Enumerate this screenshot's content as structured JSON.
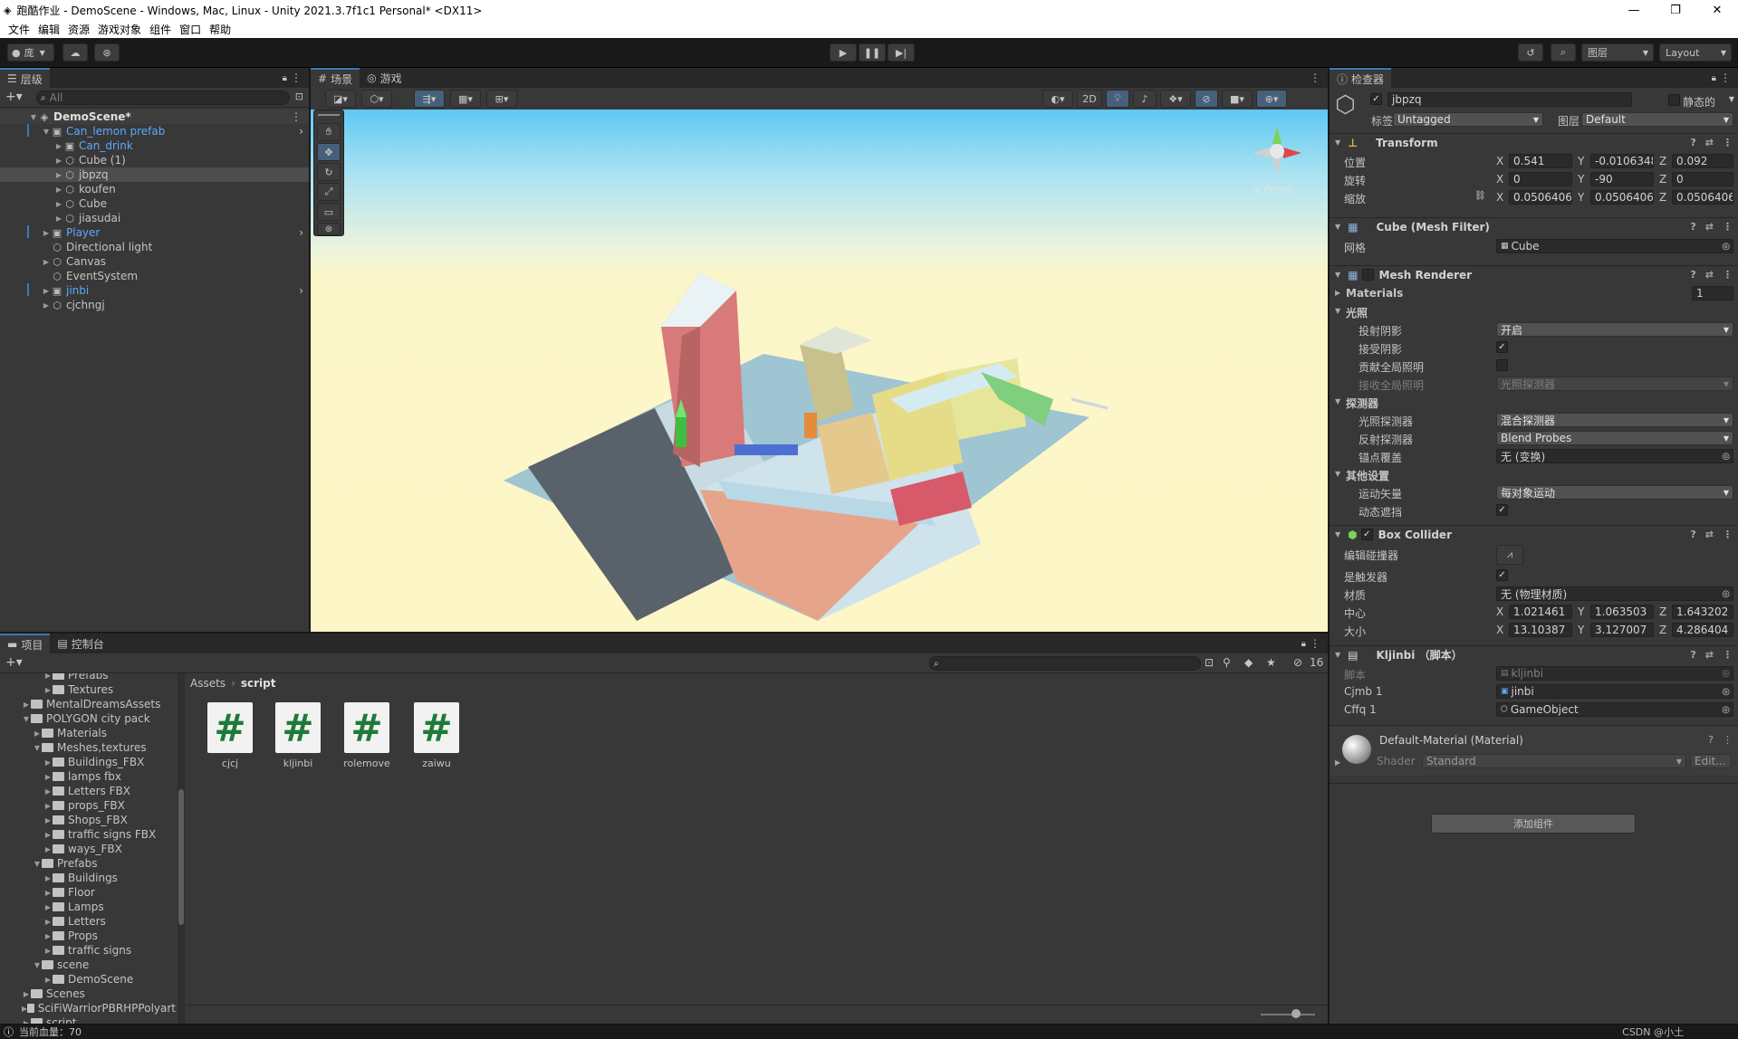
{
  "window": {
    "title": "跑酷作业 - DemoScene - Windows, Mac, Linux - Unity 2021.3.7f1c1 Personal* <DX11>",
    "controls": [
      "—",
      "❐",
      "✕"
    ]
  },
  "menu": [
    "文件",
    "编辑",
    "资源",
    "游戏对象",
    "组件",
    "窗口",
    "帮助"
  ],
  "toolbar": {
    "account": "庞",
    "layers": "图层",
    "layout": "Layout"
  },
  "hierarchy": {
    "tab": "层级",
    "search_placeholder": "All",
    "scene": "DemoScene*",
    "items": [
      {
        "label": "Can_lemon prefab",
        "prefab": true
      },
      {
        "label": "Can_drink",
        "prefab": true
      },
      {
        "label": "Cube (1)",
        "prefab": false
      },
      {
        "label": "jbpzq",
        "prefab": false
      },
      {
        "label": "koufen",
        "prefab": false
      },
      {
        "label": "Cube",
        "prefab": false
      },
      {
        "label": "jiasudai",
        "prefab": false
      },
      {
        "label": "Player",
        "prefab": true
      },
      {
        "label": "Directional light",
        "prefab": false
      },
      {
        "label": "Canvas",
        "prefab": false
      },
      {
        "label": "EventSystem",
        "prefab": false
      },
      {
        "label": "jinbi",
        "prefab": true
      },
      {
        "label": "cjchngj",
        "prefab": false
      }
    ]
  },
  "scene_view": {
    "tabs": [
      "场景",
      "游戏"
    ],
    "mode_2d": "2D",
    "persp": "< Persp"
  },
  "inspector": {
    "tab": "检查器",
    "object_name": "jbpzq",
    "static_label": "静态的",
    "tag_label": "标签",
    "tag_value": "Untagged",
    "layer_label": "图层",
    "layer_value": "Default",
    "transform": {
      "title": "Transform",
      "position_label": "位置",
      "rotation_label": "旋转",
      "scale_label": "缩放",
      "position": {
        "x": "0.541",
        "y": "-0.0106348",
        "z": "0.092"
      },
      "rotation": {
        "x": "0",
        "y": "-90",
        "z": "0"
      },
      "scale": {
        "x": "0.0506406",
        "y": "0.0506406",
        "z": "0.0506406"
      }
    },
    "mesh_filter": {
      "title": "Cube (Mesh Filter)",
      "mesh_label": "网格",
      "mesh_value": "Cube"
    },
    "mesh_renderer": {
      "title": "Mesh Renderer",
      "materials_label": "Materials",
      "materials_count": "1",
      "lighting_label": "光照",
      "cast_shadows_label": "投射阴影",
      "cast_shadows_value": "开启",
      "receive_shadows_label": "接受阴影",
      "contribute_gi_label": "贡献全局照明",
      "receive_gi_label": "接收全局照明",
      "receive_gi_value": "光照探测器",
      "probes_label": "探测器",
      "light_probes_label": "光照探测器",
      "light_probes_value": "混合探测器",
      "reflection_probes_label": "反射探测器",
      "reflection_probes_value": "Blend Probes",
      "anchor_label": "锚点覆盖",
      "anchor_value": "无 (变换)",
      "other_label": "其他设置",
      "motion_label": "运动矢量",
      "motion_value": "每对象运动",
      "dynamic_occlusion_label": "动态遮挡"
    },
    "box_collider": {
      "title": "Box Collider",
      "edit_label": "编辑碰撞器",
      "trigger_label": "是触发器",
      "material_label": "材质",
      "material_value": "无 (物理材质)",
      "center_label": "中心",
      "center": {
        "x": "1.021461",
        "y": "1.063503",
        "z": "1.643202"
      },
      "size_label": "大小",
      "size": {
        "x": "13.10387",
        "y": "3.127007",
        "z": "4.286404"
      }
    },
    "script": {
      "title": "Kljinbi （脚本）",
      "script_label": "脚本",
      "script_value": "kljinbi",
      "cjmb_label": "Cjmb 1",
      "cjmb_value": "jinbi",
      "cffq_label": "Cffq 1",
      "cffq_value": "GameObject"
    },
    "material": {
      "title": "Default-Material (Material)",
      "shader_label": "Shader",
      "shader_value": "Standard",
      "edit_label": "Edit..."
    },
    "add_component": "添加组件"
  },
  "project": {
    "tabs": [
      "项目",
      "控制台"
    ],
    "hidden_count": "16",
    "breadcrumb": [
      "Assets",
      "script"
    ],
    "tree": [
      {
        "label": "Prefabs",
        "indent": 3
      },
      {
        "label": "Textures",
        "indent": 3
      },
      {
        "label": "MentalDreamsAssets",
        "indent": 1
      },
      {
        "label": "POLYGON city pack",
        "indent": 1
      },
      {
        "label": "Materials",
        "indent": 2
      },
      {
        "label": "Meshes,textures",
        "indent": 2
      },
      {
        "label": "Buildings_FBX",
        "indent": 3
      },
      {
        "label": "lamps fbx",
        "indent": 3
      },
      {
        "label": "Letters FBX",
        "indent": 3
      },
      {
        "label": "props_FBX",
        "indent": 3
      },
      {
        "label": "Shops_FBX",
        "indent": 3
      },
      {
        "label": "traffic signs FBX",
        "indent": 3
      },
      {
        "label": "ways_FBX",
        "indent": 3
      },
      {
        "label": "Prefabs",
        "indent": 2
      },
      {
        "label": "Buildings",
        "indent": 3
      },
      {
        "label": "Floor",
        "indent": 3
      },
      {
        "label": "Lamps",
        "indent": 3
      },
      {
        "label": "Letters",
        "indent": 3
      },
      {
        "label": "Props",
        "indent": 3
      },
      {
        "label": "traffic signs",
        "indent": 3
      },
      {
        "label": "scene",
        "indent": 2
      },
      {
        "label": "DemoScene",
        "indent": 3
      },
      {
        "label": "Scenes",
        "indent": 1
      },
      {
        "label": "SciFiWarriorPBRHPPolyart",
        "indent": 1
      },
      {
        "label": "script",
        "indent": 1
      }
    ],
    "assets": [
      "cjcj",
      "kljinbi",
      "rolemove",
      "zaiwu"
    ]
  },
  "status": {
    "message": "当前血量：70",
    "watermark": "CSDN @小土"
  },
  "colors": {
    "accent": "#3a79bb",
    "prefab_blue": "#5ca9ff",
    "script_green": "#1f7a3a"
  }
}
